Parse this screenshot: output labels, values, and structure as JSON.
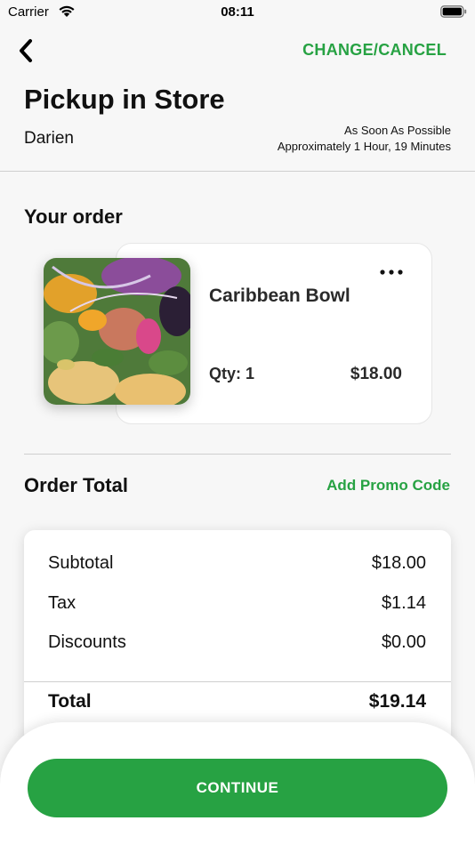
{
  "status_bar": {
    "carrier": "Carrier",
    "time": "08:11",
    "icons": [
      "wifi-icon",
      "battery-icon"
    ]
  },
  "header": {
    "back_icon": "chevron-left-icon",
    "change_cancel_label": "CHANGE/CANCEL",
    "title": "Pickup in Store",
    "store_name": "Darien",
    "timing_line1": "As Soon As Possible",
    "timing_line2": "Approximately 1 Hour, 19 Minutes"
  },
  "order": {
    "section_title": "Your order",
    "items": [
      {
        "name": "Caribbean Bowl",
        "qty_label": "Qty: 1",
        "price": "$18.00",
        "more_icon": "more-dots-icon"
      }
    ]
  },
  "totals": {
    "section_title": "Order Total",
    "promo_label": "Add Promo Code",
    "subtotal_label": "Subtotal",
    "subtotal_value": "$18.00",
    "tax_label": "Tax",
    "tax_value": "$1.14",
    "discounts_label": "Discounts",
    "discounts_value": "$0.00",
    "total_label": "Total",
    "total_value": "$19.14"
  },
  "footer": {
    "continue_label": "CONTINUE"
  },
  "colors": {
    "accent": "#27a243",
    "background": "#f7f7f7",
    "card": "#ffffff",
    "text": "#111111"
  }
}
